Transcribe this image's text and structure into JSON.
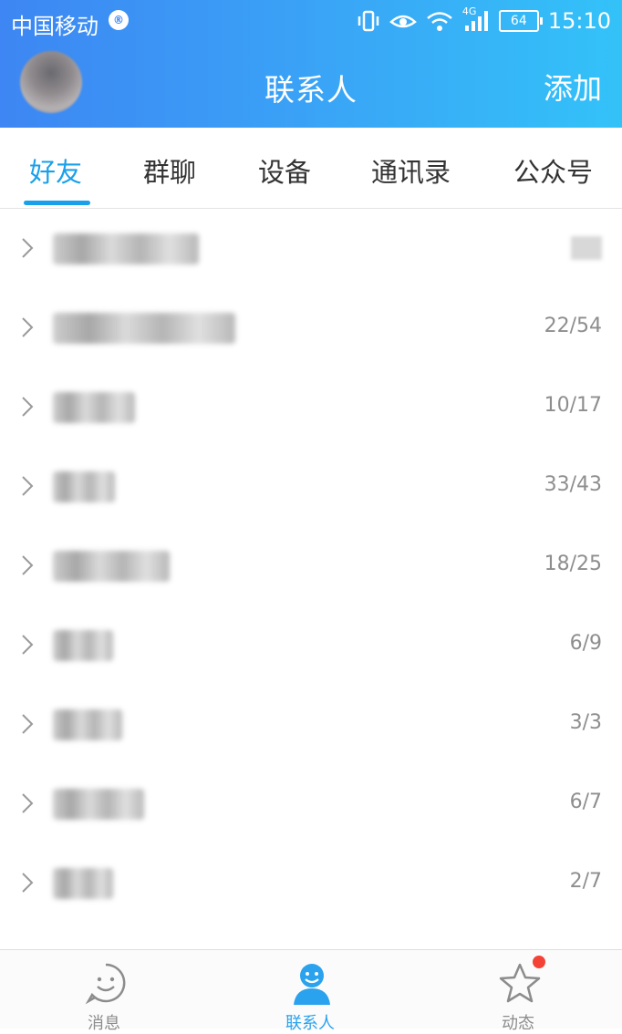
{
  "status_bar": {
    "carrier": "中国移动",
    "carrier_icon_glyph": "®",
    "network": "4G",
    "battery": "64",
    "time": "15:10"
  },
  "title_bar": {
    "title": "联系人",
    "add_label": "添加"
  },
  "tabs": [
    {
      "label": "好友",
      "active": true
    },
    {
      "label": "群聊",
      "active": false
    },
    {
      "label": "设备",
      "active": false
    },
    {
      "label": "通讯录",
      "active": false
    },
    {
      "label": "公众号",
      "active": false
    }
  ],
  "groups": [
    {
      "name": "",
      "count": ""
    },
    {
      "name": "",
      "count": "22/54"
    },
    {
      "name": "",
      "count": "10/17"
    },
    {
      "name": "",
      "count": "33/43"
    },
    {
      "name": "",
      "count": "18/25"
    },
    {
      "name": "",
      "count": "6/9"
    },
    {
      "name": "",
      "count": "3/3"
    },
    {
      "name": "",
      "count": "6/7"
    },
    {
      "name": "",
      "count": "2/7"
    }
  ],
  "bottom_nav": [
    {
      "label": "消息",
      "icon": "smiley-chat-icon",
      "active": false
    },
    {
      "label": "联系人",
      "icon": "person-icon",
      "active": true
    },
    {
      "label": "动态",
      "icon": "star-icon",
      "active": false,
      "badge": true
    }
  ],
  "colors": {
    "accent": "#1aa0ea",
    "header_start": "#3d86f3",
    "header_end": "#33c2f8",
    "badge": "#f44336"
  }
}
